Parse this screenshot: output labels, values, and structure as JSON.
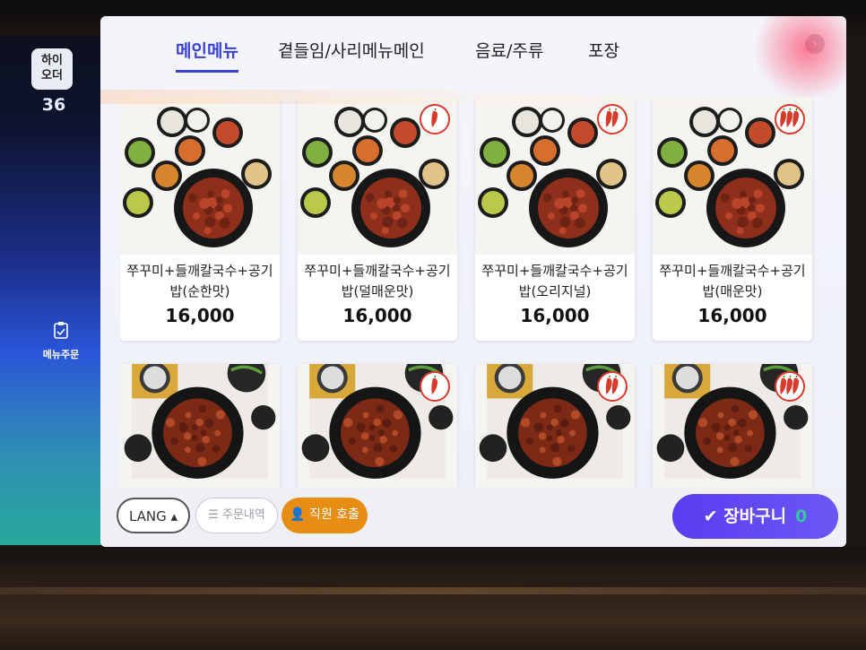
{
  "brand": {
    "logo_text": "하이\n오더",
    "table_number": "36"
  },
  "rail": {
    "order_label": "메뉴주문"
  },
  "tabs": [
    {
      "label": "메인메뉴",
      "active": true
    },
    {
      "label": "곁들임/사리메뉴메인",
      "active": false
    },
    {
      "label": "음료/주류",
      "active": false
    },
    {
      "label": "포장",
      "active": false
    }
  ],
  "menu_items": [
    {
      "name": "쭈꾸미+들깨칼국수+공기밥(순한맛)",
      "price": "16,000",
      "spice": 0
    },
    {
      "name": "쭈꾸미+들깨칼국수+공기밥(덜매운맛)",
      "price": "16,000",
      "spice": 1
    },
    {
      "name": "쭈꾸미+들깨칼국수+공기밥(오리지널)",
      "price": "16,000",
      "spice": 2
    },
    {
      "name": "쭈꾸미+들깨칼국수+공기밥(매운맛)",
      "price": "16,000",
      "spice": 3
    },
    {
      "name": "",
      "price": "",
      "spice": 0
    },
    {
      "name": "",
      "price": "",
      "spice": 1
    },
    {
      "name": "",
      "price": "",
      "spice": 2
    },
    {
      "name": "",
      "price": "",
      "spice": 3
    }
  ],
  "bottom_bar": {
    "lang_label": "LANG ▴",
    "history_label": "☰  주문내역",
    "staff_call_label": "직원 호출",
    "cart_label": "장바구니",
    "cart_count": "0"
  },
  "colors": {
    "accent": "#3a3fd6",
    "cart": "#5a3df0",
    "staff_call": "#e88d14",
    "pepper": "#d83a2b"
  }
}
